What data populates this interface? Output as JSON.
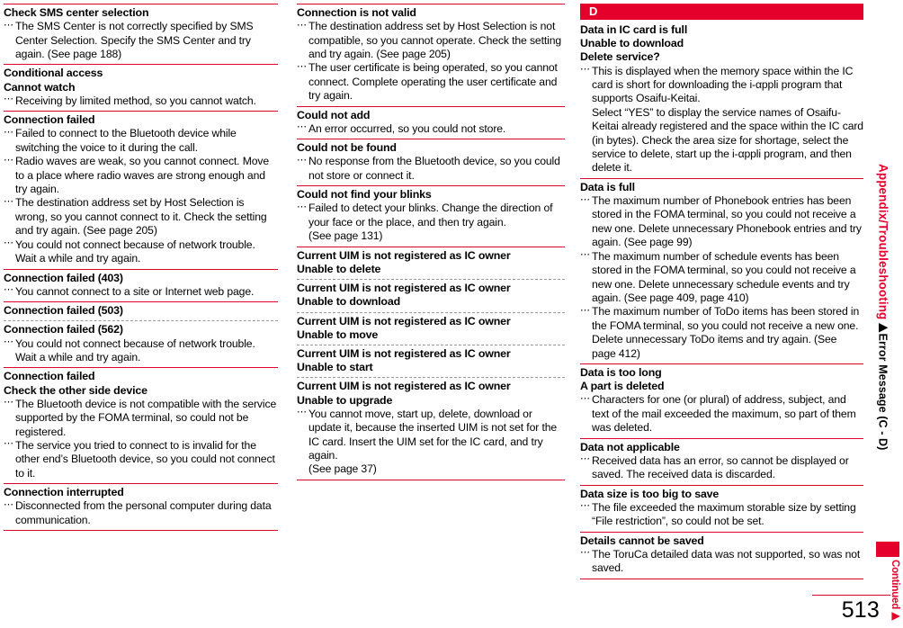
{
  "page": {
    "number": "513",
    "continued_label": "Continued",
    "continued_arrow": "▶"
  },
  "sidebar": {
    "chapter_label": "Appendix/Troubleshooting",
    "section_label": "▶Error Message (C - D)"
  },
  "marker": "⋯",
  "columns": [
    {
      "id": "column-1",
      "entries": [
        {
          "terms": [
            "Check SMS center selection"
          ],
          "rule": "red",
          "descs": [
            {
              "lines": [
                "The SMS Center is not correctly specified by SMS Center Selection. Specify the SMS Center and try again. (See page 188)"
              ]
            }
          ]
        },
        {
          "terms": [
            "Conditional access",
            "Cannot watch"
          ],
          "rule": "red",
          "descs": [
            {
              "lines": [
                "Receiving by limited method, so you cannot watch."
              ]
            }
          ]
        },
        {
          "terms": [
            "Connection failed"
          ],
          "rule": "red",
          "descs": [
            {
              "lines": [
                "Failed to connect to the Bluetooth device while switching the voice to it during the call."
              ]
            },
            {
              "lines": [
                "Radio waves are weak, so you cannot connect. Move to a place where radio waves are strong enough and try again."
              ]
            },
            {
              "lines": [
                "The destination address set by Host Selection is wrong, so you cannot connect to it. Check the setting and try again. (See page 205)"
              ]
            },
            {
              "lines": [
                "You could not connect because of network trouble. Wait a while and try again."
              ]
            }
          ]
        },
        {
          "terms": [
            "Connection failed (403)"
          ],
          "rule": "red",
          "descs": [
            {
              "lines": [
                "You cannot connect to a site or Internet web page."
              ]
            }
          ]
        },
        {
          "terms": [
            "Connection failed (503)"
          ],
          "rule": "red",
          "descs": []
        },
        {
          "terms": [
            "Connection failed (562)"
          ],
          "rule": "dashed",
          "descs": [
            {
              "lines": [
                "You could not connect because of network trouble. Wait a while and try again."
              ]
            }
          ]
        },
        {
          "terms": [
            "Connection failed",
            "Check the other side device"
          ],
          "rule": "red",
          "descs": [
            {
              "lines": [
                "The Bluetooth device is not compatible with the service supported by the FOMA terminal, so could not be registered."
              ]
            },
            {
              "lines": [
                "The service you tried to connect to is invalid for the other end’s Bluetooth device, so you could not connect to it."
              ]
            }
          ]
        },
        {
          "terms": [
            "Connection interrupted"
          ],
          "rule": "red",
          "last": true,
          "descs": [
            {
              "lines": [
                "Disconnected from the personal computer during data communication."
              ]
            }
          ]
        }
      ]
    },
    {
      "id": "column-2",
      "entries": [
        {
          "terms": [
            "Connection is not valid"
          ],
          "rule": "red",
          "descs": [
            {
              "lines": [
                "The destination address set by Host Selection is not compatible, so you cannot operate. Check the setting and try again. (See page 205)"
              ]
            },
            {
              "lines": [
                "The user certificate is being operated, so you cannot connect. Complete operating the user certificate and try again."
              ]
            }
          ]
        },
        {
          "terms": [
            "Could not add"
          ],
          "rule": "red",
          "descs": [
            {
              "lines": [
                "An error occurred, so you could not store."
              ]
            }
          ]
        },
        {
          "terms": [
            "Could not be found"
          ],
          "rule": "red",
          "descs": [
            {
              "lines": [
                "No response from the Bluetooth device, so you could not store or connect it."
              ]
            }
          ]
        },
        {
          "terms": [
            "Could not find your blinks"
          ],
          "rule": "red",
          "descs": [
            {
              "lines": [
                "Failed to detect your blinks. Change the direction of your face or the place, and then try again.",
                "(See page 131)"
              ]
            }
          ]
        },
        {
          "terms": [
            "Current UIM is not registered as IC owner",
            "Unable to delete"
          ],
          "rule": "red",
          "descs": []
        },
        {
          "terms": [
            "Current UIM is not registered as IC owner",
            "Unable to download"
          ],
          "rule": "dashed",
          "descs": []
        },
        {
          "terms": [
            "Current UIM is not registered as IC owner",
            "Unable to move"
          ],
          "rule": "dashed",
          "descs": []
        },
        {
          "terms": [
            "Current UIM is not registered as IC owner",
            "Unable to start"
          ],
          "rule": "dashed",
          "descs": []
        },
        {
          "terms": [
            "Current UIM is not registered as IC owner",
            "Unable to upgrade"
          ],
          "rule": "dashed",
          "last": true,
          "descs": [
            {
              "lines": [
                "You cannot move, start up, delete, download or update it, because the inserted UIM is not set for the IC card. Insert the UIM set for the IC card, and try again.",
                "(See page 37)"
              ]
            }
          ]
        }
      ]
    },
    {
      "id": "column-3",
      "section_header": "D",
      "entries": [
        {
          "terms": [
            "Data in IC card is full",
            "Unable to download",
            "Delete service?"
          ],
          "rule": "none",
          "descs": [
            {
              "lines": [
                "This is displayed when the memory space within the IC card is short for downloading the i-αppli program that supports Osaifu-Keitai.",
                "Select “YES” to display the service names of Osaifu-Keitai already registered and the space within the IC card (in bytes). Check the area size for shortage, select the service to delete, start up the i-αppli program, and then delete it."
              ]
            }
          ]
        },
        {
          "terms": [
            "Data is full"
          ],
          "rule": "red",
          "descs": [
            {
              "lines": [
                "The maximum number of Phonebook entries has been stored in the FOMA terminal, so you could not receive a new one. Delete unnecessary Phonebook entries and try again. (See page 99)"
              ]
            },
            {
              "lines": [
                "The maximum number of schedule events has been stored in the FOMA terminal, so you could not receive a new one. Delete unnecessary schedule events and try again. (See page 409, page 410)"
              ]
            },
            {
              "lines": [
                "The maximum number of ToDo items has been stored in the FOMA terminal, so you could not receive a new one. Delete unnecessary ToDo items and try again. (See page 412)"
              ]
            }
          ]
        },
        {
          "terms": [
            "Data is too long",
            "A part is deleted"
          ],
          "rule": "red",
          "descs": [
            {
              "lines": [
                "Characters for one (or plural) of address, subject, and text of the mail exceeded the maximum, so part of them was deleted."
              ]
            }
          ]
        },
        {
          "terms": [
            "Data not applicable"
          ],
          "rule": "red",
          "descs": [
            {
              "lines": [
                "Received data has an error, so cannot be displayed or saved. The received data is discarded."
              ]
            }
          ]
        },
        {
          "terms": [
            "Data size is too big to save"
          ],
          "rule": "red",
          "descs": [
            {
              "lines": [
                "The file exceeded the maximum storable size by setting “File restriction”, so could not be set."
              ]
            }
          ]
        },
        {
          "terms": [
            "Details cannot be saved"
          ],
          "rule": "red",
          "last": true,
          "descs": [
            {
              "lines": [
                "The ToruCa detailed data was not supported, so was not saved."
              ]
            }
          ]
        }
      ]
    }
  ]
}
